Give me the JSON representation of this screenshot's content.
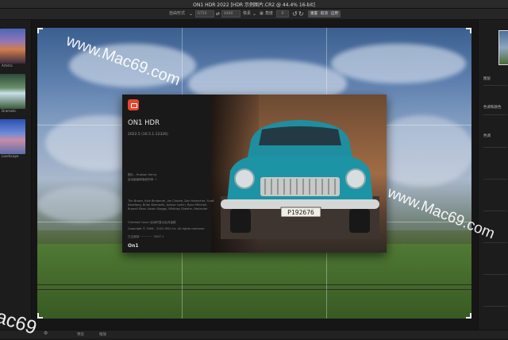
{
  "window": {
    "title": "ON1 HDR 2022 [HDR 示例图片.CR2 @ 44.4% 16-bit]"
  },
  "toolbar": {
    "mode_label": "自由形式",
    "width_value": "6750",
    "height_value": "4480",
    "unit_label": "像素",
    "angle_label": "角度",
    "angle_value": "0",
    "btn_reset": "重置",
    "btn_cancel": "取消",
    "btn_apply": "应用"
  },
  "left_panel": {
    "presets": [
      {
        "label": "Artistic"
      },
      {
        "label": "Dramatic"
      },
      {
        "label": "Landscape"
      }
    ]
  },
  "about": {
    "app_name": "ON1 HDR",
    "version": "2022.5 (16.5.1.12326)",
    "credit_line1": "图片 - Hudson Henry",
    "credit_line2": "启动画面和版权所有 →",
    "team": "Tim Brown, Kyle Birnbaum, Jim Choate, Dan Harlacher, Scott Kasefang, Brian Kormanik, Joshua Larkin, Ryan Mitchell, Russell Shea, Aaron Staggs, Whitney Sheehe, Harlacher",
    "checkbox_text": "Checked Cover 启动时显示此对话框",
    "copyright": "Copyright © 2006 - 2022 ON1 Inc. All rights reserved.",
    "license": "已注册到 ·············· 3207-1",
    "brand_mark": "On1"
  },
  "right_panel": {
    "section_layers": "图层",
    "section_color": "色调和颜色",
    "section_tone": "色调"
  },
  "statusbar": {
    "label_preview": "预览",
    "label_zoom": "缩放"
  },
  "watermarks": [
    "www.Mac69.com",
    "www.Mac69.com",
    "ac69"
  ],
  "plate": "P192676"
}
